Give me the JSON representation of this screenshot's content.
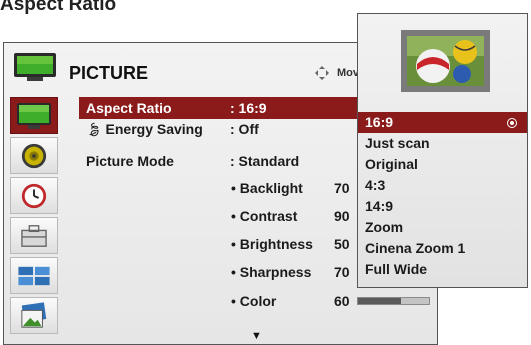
{
  "page": {
    "heading": "Aspect Ratio"
  },
  "menu": {
    "title": "PICTURE",
    "move_hint": "Mov",
    "settings": [
      {
        "label": "Aspect Ratio",
        "value": ": 16:9",
        "selected": true
      },
      {
        "label": "Energy Saving",
        "value": ": Off",
        "icon": "eco-icon"
      },
      {
        "label": "Picture Mode",
        "value": ": Standard"
      }
    ],
    "sub_settings": [
      {
        "label": "• Backlight",
        "value": "70",
        "level_percent": 70
      },
      {
        "label": "• Contrast",
        "value": "90",
        "level_percent": 90
      },
      {
        "label": "• Brightness",
        "value": "50",
        "level_percent": 50
      },
      {
        "label": "• Sharpness",
        "value": "70",
        "level_percent": 70
      },
      {
        "label": "• Color",
        "value": "60",
        "level_percent": 60
      }
    ],
    "scroll_indicator": "▼",
    "sidebar": [
      "picture-icon",
      "audio-icon",
      "time-icon",
      "option-icon",
      "input-icon",
      "photo-icon"
    ]
  },
  "aspect_popup": {
    "options": [
      "16:9",
      "Just scan",
      "Original",
      "4:3",
      "14:9",
      "Zoom",
      "Cinena Zoom 1",
      "Full Wide"
    ],
    "selected": "16:9"
  },
  "colors": {
    "accent": "#8b1a1a",
    "panel": "#ececec",
    "bar_fill": "#5a5a5a"
  }
}
